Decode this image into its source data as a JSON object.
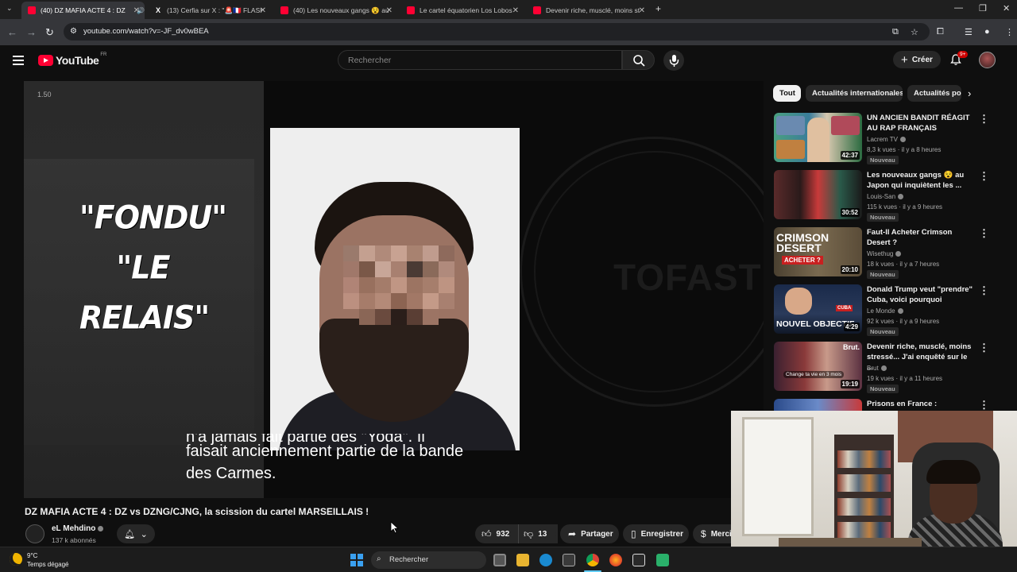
{
  "browser": {
    "tabs": [
      {
        "title": "(40) DZ MAFIA ACTE 4 : DZ",
        "active": true,
        "icon": "youtube-icon"
      },
      {
        "title": "(13) Cerfia sur X : \"🚨🇫🇷 FLASH",
        "active": false,
        "icon": "x-icon"
      },
      {
        "title": "(40) Les nouveaux gangs 😵 au",
        "active": false,
        "icon": "youtube-icon"
      },
      {
        "title": "Le cartel équatorien Los Lobos",
        "active": false,
        "icon": "youtube-icon"
      },
      {
        "title": "Devenir riche, musclé, moins st",
        "active": false,
        "icon": "youtube-icon"
      }
    ],
    "url": "youtube.com/watch?v=-JF_dv0wBEA"
  },
  "youtube": {
    "logo_text": "YouTube",
    "country": "FR",
    "search_placeholder": "Rechercher",
    "create_label": "Créer",
    "notif_count": "9+"
  },
  "player": {
    "speed": "1.50",
    "overlay_line1": "\"FONDU\"",
    "overlay_line2": "\"LE RELAIS\"",
    "logo_word": "TOFAST",
    "subtitle_cut": "n'a jamais fait partie des \"Yoda\". Il",
    "subtitle_line1": "faisait anciennement partie de la bande",
    "subtitle_line2": "des Carmes."
  },
  "video": {
    "title": "DZ MAFIA ACTE 4 : DZ vs DZNG/CJNG, la scission du cartel MARSEILLAIS !",
    "channel": "eL Mehdino",
    "subscribers": "137 k abonnés",
    "likes": "932",
    "dislikes": "13",
    "share_label": "Partager",
    "save_label": "Enregistrer",
    "thanks_label": "Merci"
  },
  "sidebar": {
    "chips": [
      "Tout",
      "Actualités internationales",
      "Actualités po"
    ],
    "recommendations": [
      {
        "title": "UN ANCIEN BANDIT RÉAGIT AU RAP FRANÇAIS",
        "channel": "Lacrem TV",
        "meta": "8,3 k vues · il y a 8 heures",
        "badge": "Nouveau",
        "duration": "42:37"
      },
      {
        "title": "Les nouveaux gangs 😵 au Japon qui inquiètent les ...",
        "channel": "Louis-San",
        "meta": "115 k vues · il y a 9 heures",
        "badge": "Nouveau",
        "duration": "30:52"
      },
      {
        "title": "Faut-Il Acheter Crimson Desert ?",
        "channel": "Wisethug",
        "meta": "18 k vues · il y a 7 heures",
        "badge": "Nouveau",
        "duration": "20:10",
        "thumb_text1": "CRIMSON",
        "thumb_text2": "DESERT",
        "thumb_text3": "ACHETER ?"
      },
      {
        "title": "Donald Trump veut \"prendre\" Cuba, voici pourquoi",
        "channel": "Le Monde",
        "meta": "92 k vues · il y a 9 heures",
        "badge": "Nouveau",
        "duration": "4:29",
        "thumb_text1": "NOUVEL OBJECTIF",
        "thumb_text2": "CUBA"
      },
      {
        "title": "Devenir riche, musclé, moins stressé... J'ai enquêté sur le ...",
        "channel": "Brut",
        "meta": "19 k vues · il y a 11 heures",
        "badge": "Nouveau",
        "duration": "19:19",
        "thumb_text1": "Brut.",
        "thumb_text2": "Change ta vie en 3 mois"
      },
      {
        "title": "Prisons en France : immersion",
        "channel": "",
        "meta": "",
        "badge": "",
        "duration": ""
      }
    ]
  },
  "taskbar": {
    "temp": "9°C",
    "weather": "Temps dégagé",
    "search_label": "Rechercher"
  },
  "colors": {
    "youtube_red": "#ff0033",
    "bg": "#0f0f0f",
    "windows_blue": "#3aa0f0"
  }
}
